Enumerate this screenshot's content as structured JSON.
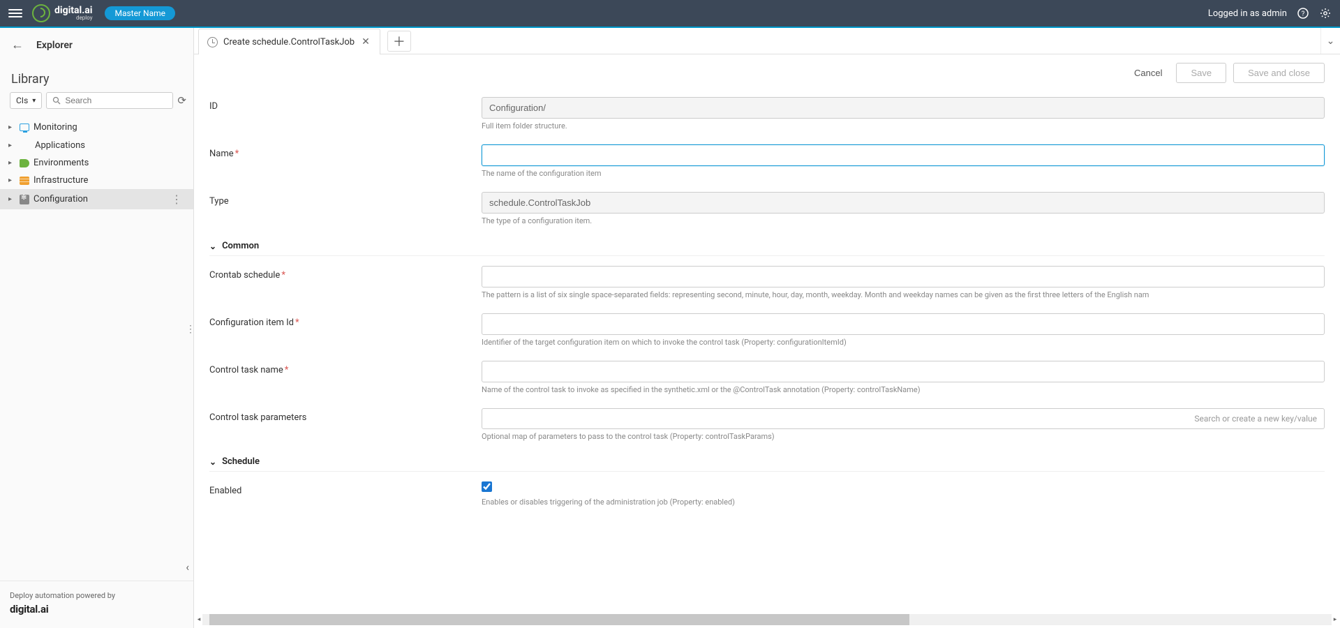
{
  "topbar": {
    "brand": "digital.ai",
    "brand_sub": "deploy",
    "master": "Master Name",
    "login": "Logged in as admin"
  },
  "sidebar": {
    "explorer": "Explorer",
    "library": "Library",
    "cis": "CIs",
    "search_placeholder": "Search",
    "tree": [
      {
        "label": "Monitoring",
        "icon": "monitor"
      },
      {
        "label": "Applications",
        "icon": "apps"
      },
      {
        "label": "Environments",
        "icon": "env"
      },
      {
        "label": "Infrastructure",
        "icon": "infra"
      },
      {
        "label": "Configuration",
        "icon": "config",
        "selected": true
      }
    ],
    "footer_line1": "Deploy automation powered by",
    "footer_brand": "digital.ai"
  },
  "tab": {
    "title": "Create schedule.ControlTaskJob"
  },
  "actions": {
    "cancel": "Cancel",
    "save": "Save",
    "save_close": "Save and close"
  },
  "form": {
    "id_label": "ID",
    "id_value": "Configuration/",
    "id_help": "Full item folder structure.",
    "name_label": "Name",
    "name_value": "",
    "name_help": "The name of the configuration item",
    "type_label": "Type",
    "type_value": "schedule.ControlTaskJob",
    "type_help": "The type of a configuration item.",
    "section_common": "Common",
    "cron_label": "Crontab schedule",
    "cron_value": "",
    "cron_help": "The pattern is a list of six single space-separated fields: representing second, minute, hour, day, month, weekday. Month and weekday names can be given as the first three letters of the English nam",
    "ciid_label": "Configuration item Id",
    "ciid_value": "",
    "ciid_help": "Identifier of the target configuration item on which to invoke the control task (Property: configurationItemId)",
    "ctname_label": "Control task name",
    "ctname_value": "",
    "ctname_help": "Name of the control task to invoke as specified in the synthetic.xml or the @ControlTask annotation (Property: controlTaskName)",
    "ctparams_label": "Control task parameters",
    "ctparams_placeholder": "Search or create a new key/value",
    "ctparams_help": "Optional map of parameters to pass to the control task (Property: controlTaskParams)",
    "section_schedule": "Schedule",
    "enabled_label": "Enabled",
    "enabled_checked": true,
    "enabled_help": "Enables or disables triggering of the administration job (Property: enabled)"
  }
}
